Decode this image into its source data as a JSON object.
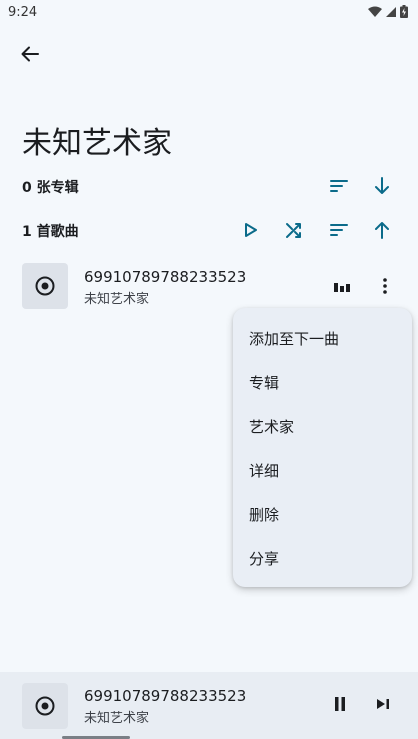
{
  "status": {
    "time": "9:24"
  },
  "header": {
    "title": "未知艺术家"
  },
  "albums": {
    "label": "0 张专辑"
  },
  "songs": {
    "label": "1 首歌曲"
  },
  "song_list": [
    {
      "title": "69910789788233523",
      "artist": "未知艺术家"
    }
  ],
  "context_menu": {
    "items": [
      "添加至下一曲",
      "专辑",
      "艺术家",
      "详细",
      "删除",
      "分享"
    ]
  },
  "player": {
    "title": "69910789788233523",
    "artist": "未知艺术家"
  },
  "colors": {
    "accent": "#0b6b8a",
    "background": "#f4f8fc",
    "menu": "#e9eef5",
    "player": "#e8edf3"
  }
}
